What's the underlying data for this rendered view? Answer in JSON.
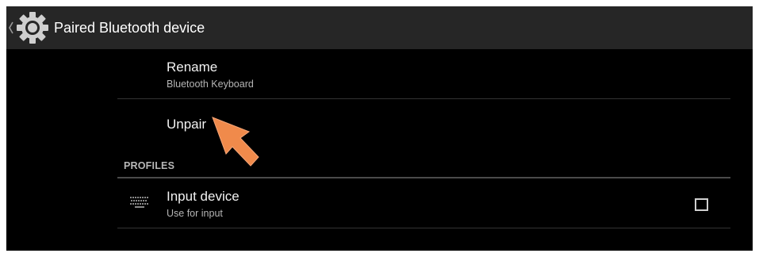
{
  "actionbar": {
    "title": "Paired Bluetooth device",
    "back_icon": "chevron-left-icon",
    "app_icon": "gear-icon"
  },
  "items": {
    "rename": {
      "title": "Rename",
      "summary": "Bluetooth Keyboard"
    },
    "unpair": {
      "title": "Unpair"
    }
  },
  "profiles": {
    "header": "PROFILES",
    "input_device": {
      "title": "Input device",
      "summary": "Use for input",
      "icon": "keyboard-icon",
      "checked": false
    }
  },
  "colors": {
    "background": "#000000",
    "actionbar": "#262626",
    "cursor_accent": "#f08a4b"
  }
}
